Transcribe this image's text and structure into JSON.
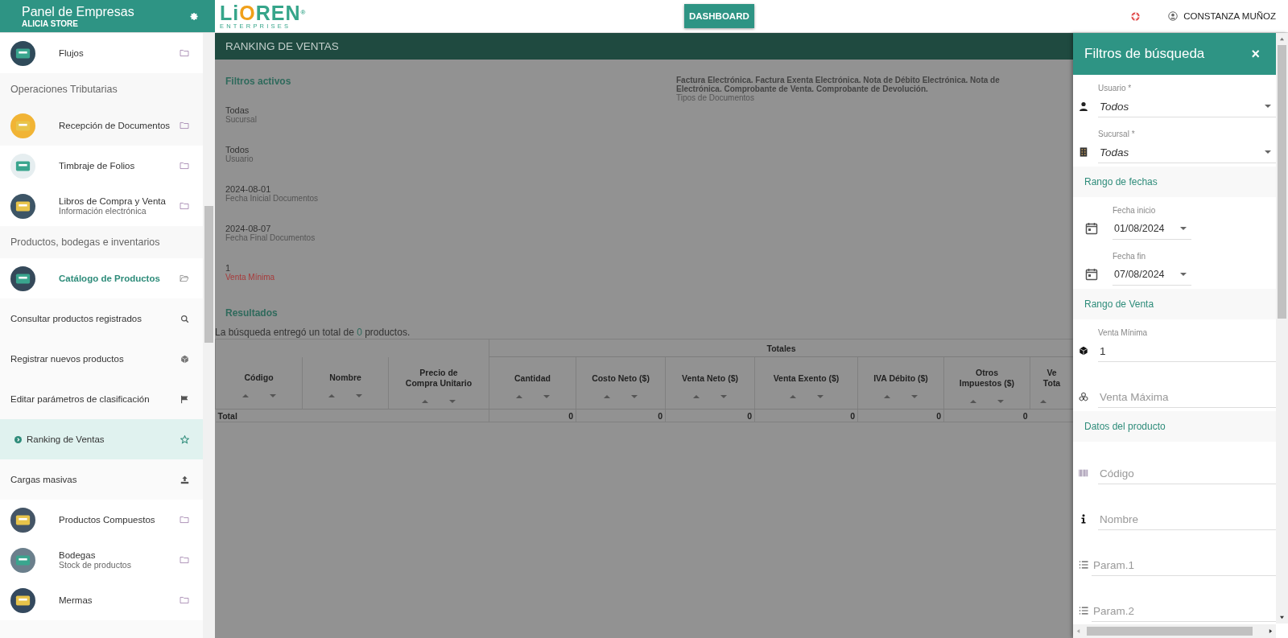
{
  "sidebar": {
    "title": "Panel de Empresas",
    "subtitle": "ALICIA STORE",
    "items": [
      {
        "kind": "module",
        "label": "Flujos",
        "expanded": false
      },
      {
        "kind": "section",
        "label": "Operaciones Tributarias"
      },
      {
        "kind": "module",
        "label": "Recepción de Documentos",
        "expanded": false
      },
      {
        "kind": "module",
        "label": "Timbraje de Folios",
        "expanded": false
      },
      {
        "kind": "module",
        "label": "Libros de Compra y Venta",
        "sublabel": "Información electrónica",
        "expanded": false
      },
      {
        "kind": "section",
        "label": "Productos, bodegas e inventarios"
      },
      {
        "kind": "module",
        "label": "Catálogo de Productos",
        "expanded": true,
        "children": [
          {
            "label": "Consultar productos registrados",
            "selected": false
          },
          {
            "label": "Registrar nuevos productos",
            "selected": false
          },
          {
            "label": "Editar parámetros de clasificación",
            "selected": false
          },
          {
            "label": "Ranking de Ventas",
            "selected": true
          },
          {
            "label": "Cargas masivas",
            "selected": false
          }
        ]
      },
      {
        "kind": "module",
        "label": "Productos Compuestos",
        "expanded": false
      },
      {
        "kind": "module",
        "label": "Bodegas",
        "sublabel": "Stock de productos",
        "expanded": false
      },
      {
        "kind": "module",
        "label": "Mermas",
        "expanded": false
      }
    ]
  },
  "topbar": {
    "logo": {
      "text": "LiOREN",
      "mark": "®",
      "tagline": "ENTERPRISES"
    },
    "dashboard_button": "DASHBOARD",
    "user": "CONSTANZA MUÑOZ"
  },
  "page": {
    "title": "RANKING DE VENTAS",
    "active_filters_heading": "Filtros activos",
    "active_filters": [
      {
        "value": "Todas",
        "label": "Sucursal",
        "color": "#555555"
      },
      {
        "value": "Todos",
        "label": "Usuario",
        "color": "#555555"
      },
      {
        "value": "2024-08-01",
        "label": "Fecha Inicial Documentos",
        "color": "#555555"
      },
      {
        "value": "2024-08-07",
        "label": "Fecha Final Documentos",
        "color": "#555555"
      },
      {
        "value": "1",
        "label": "Venta Mínima",
        "color": "#a83a3a"
      }
    ],
    "document_types": {
      "lines": [
        "Factura Electrónica. Factura Exenta Electrónica. Nota de Débito Electrónica. Nota de",
        "Electrónica. Comprobante de Venta. Comprobante de Devolución."
      ],
      "label": "Tipos de Documentos"
    },
    "results_heading": "Resultados",
    "results_text": {
      "before": "La búsqueda entregó un total de",
      "count": "0",
      "after": "productos."
    },
    "table": {
      "group_header": "Totales",
      "columns": [
        "Código",
        "Nombre",
        "Precio de\nCompra Unitario",
        "Cantidad",
        "Costo Neto ($)",
        "Venta Neto ($)",
        "Venta Exento ($)",
        "IVA Débito ($)",
        "Otros\nImpuestos ($)",
        "Ve\nTota"
      ],
      "total_row": {
        "label": "Total",
        "values": [
          "0",
          "0",
          "0",
          "0",
          "0",
          "0"
        ]
      }
    }
  },
  "filter_panel": {
    "title": "Filtros de búsqueda",
    "close": "×",
    "items": [
      {
        "kind": "select",
        "label": "Usuario *",
        "value": "Todos"
      },
      {
        "kind": "select",
        "label": "Sucursal *",
        "value": "Todas"
      },
      {
        "kind": "section",
        "label": "Rango de fechas"
      },
      {
        "kind": "date",
        "label": "Fecha inicio",
        "value": "01/08/2024"
      },
      {
        "kind": "date",
        "label": "Fecha fin",
        "value": "07/08/2024"
      },
      {
        "kind": "section",
        "label": "Rango de Venta"
      },
      {
        "kind": "input",
        "label": "Venta Mínima",
        "value": "1"
      },
      {
        "kind": "input",
        "placeholder": "Venta Máxima"
      },
      {
        "kind": "section",
        "label": "Datos del producto"
      },
      {
        "kind": "input",
        "placeholder": "Código"
      },
      {
        "kind": "input",
        "placeholder": "Nombre"
      },
      {
        "kind": "input",
        "placeholder": "Param.1"
      },
      {
        "kind": "input",
        "placeholder": "Param.2"
      }
    ]
  }
}
